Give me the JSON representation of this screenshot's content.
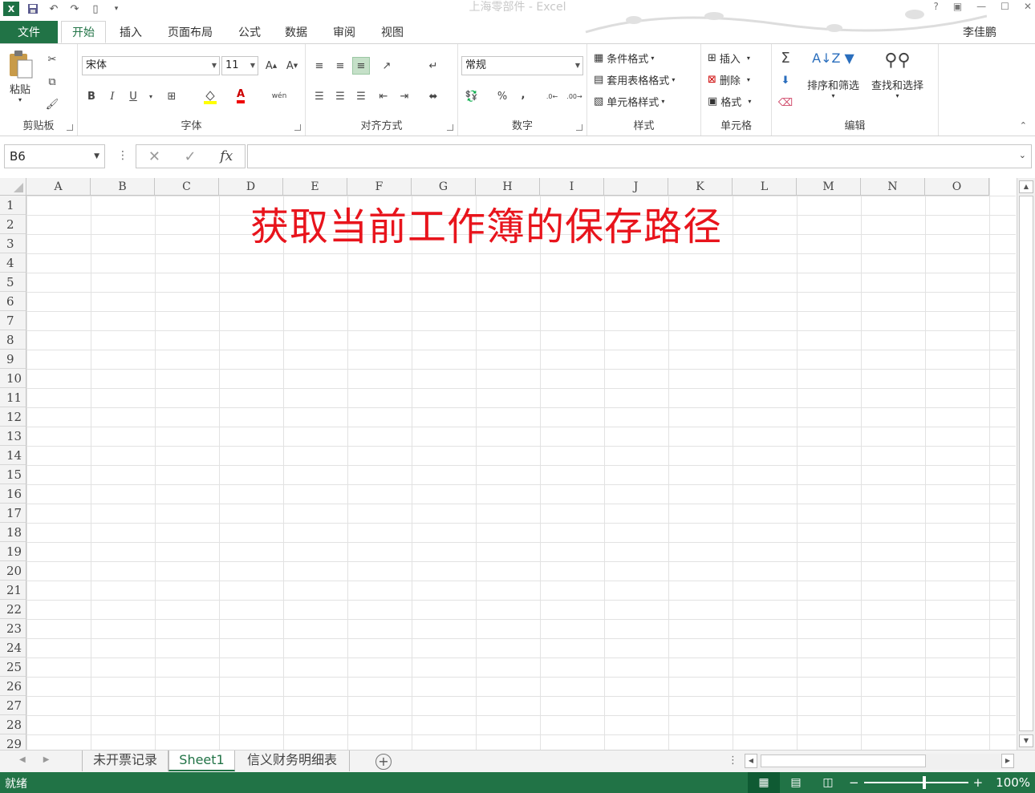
{
  "window": {
    "title": "上海零部件 - Excel",
    "help": "?",
    "user": "李佳鹏"
  },
  "menu": {
    "file": "文件",
    "tabs": [
      "开始",
      "插入",
      "页面布局",
      "公式",
      "数据",
      "审阅",
      "视图"
    ],
    "active_tab": "开始"
  },
  "ribbon": {
    "clipboard": {
      "label": "剪贴板",
      "paste": "粘贴"
    },
    "font": {
      "label": "字体",
      "font_name": "宋体",
      "font_size": "11",
      "bold": "B",
      "italic": "I",
      "underline": "U",
      "font_color_glyph": "A",
      "phonetic": "wén"
    },
    "alignment": {
      "label": "对齐方式"
    },
    "number": {
      "label": "数字",
      "format": "常规",
      "percent": "%",
      "comma": ",",
      "inc_decimal": "←.0 .00",
      "dec_decimal": ".00 →.0"
    },
    "styles": {
      "label": "样式",
      "conditional": "条件格式",
      "table_format": "套用表格格式",
      "cell_styles": "单元格样式"
    },
    "cells": {
      "label": "单元格",
      "insert": "插入",
      "delete": "删除",
      "format": "格式"
    },
    "editing": {
      "label": "编辑",
      "sum": "Σ",
      "sort_filter": "排序和筛选",
      "find_select": "查找和选择"
    }
  },
  "formula_bar": {
    "name_box": "B6",
    "fx": "fx",
    "value": ""
  },
  "grid": {
    "columns": [
      "A",
      "B",
      "C",
      "D",
      "E",
      "F",
      "G",
      "H",
      "I",
      "J",
      "K",
      "L",
      "M",
      "N",
      "O"
    ],
    "rows": [
      "1",
      "2",
      "3",
      "4",
      "5",
      "6",
      "7",
      "8",
      "9",
      "10",
      "11",
      "12",
      "13",
      "14",
      "15",
      "16",
      "17",
      "18",
      "19",
      "20",
      "21",
      "22",
      "23",
      "24",
      "25",
      "26",
      "27",
      "28",
      "29"
    ],
    "overlay_text": "获取当前工作簿的保存路径",
    "overlay_color": "#e8141c"
  },
  "sheets": {
    "tabs": [
      "未开票记录",
      "Sheet1",
      "信义财务明细表"
    ],
    "active": "Sheet1",
    "add": "+"
  },
  "status": {
    "ready": "就绪",
    "zoom": "100%",
    "minus": "−",
    "plus": "+"
  },
  "colors": {
    "accent": "#217346",
    "grid_line": "#e2e2e2",
    "header_bg": "#f3f3f3"
  }
}
